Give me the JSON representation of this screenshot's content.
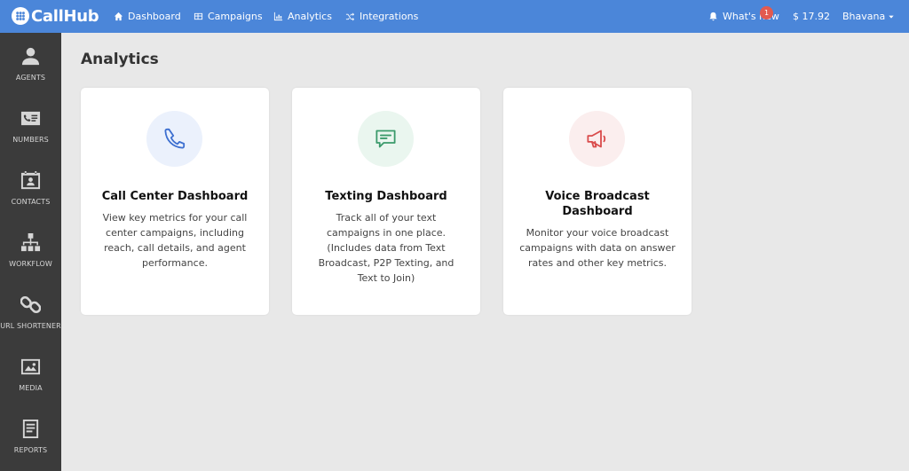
{
  "app": {
    "logo_text": "CallHub"
  },
  "topnav": {
    "items": [
      {
        "label": "Dashboard",
        "icon": "home-icon"
      },
      {
        "label": "Campaigns",
        "icon": "grid-icon"
      },
      {
        "label": "Analytics",
        "icon": "chart-icon"
      },
      {
        "label": "Integrations",
        "icon": "shuffle-icon"
      }
    ],
    "whats_new": {
      "label": "What's new",
      "badge": "1"
    },
    "balance": "$ 17.92",
    "user": "Bhavana"
  },
  "sidebar": {
    "items": [
      {
        "label": "AGENTS",
        "icon": "agent-icon"
      },
      {
        "label": "NUMBERS",
        "icon": "phone-card-icon"
      },
      {
        "label": "CONTACTS",
        "icon": "contact-card-icon"
      },
      {
        "label": "WORKFLOW",
        "icon": "sitemap-icon"
      },
      {
        "label": "URL SHORTENER",
        "icon": "link-icon"
      },
      {
        "label": "MEDIA",
        "icon": "image-icon"
      },
      {
        "label": "REPORTS",
        "icon": "document-icon"
      }
    ]
  },
  "main": {
    "title": "Analytics",
    "cards": [
      {
        "title": "Call Center Dashboard",
        "description": "View key metrics for your call center campaigns, including reach, call details, and agent performance.",
        "icon": "phone-icon",
        "accent": "#3d6fd0",
        "circle_bg": "#ebf1fc"
      },
      {
        "title": "Texting Dashboard",
        "description": "Track all of your text campaigns in one place. (Includes data from Text Broadcast, P2P Texting, and Text to Join)",
        "icon": "message-icon",
        "accent": "#3b9a6b",
        "circle_bg": "#eaf6ef"
      },
      {
        "title": "Voice Broadcast Dashboard",
        "description": "Monitor your voice broadcast campaigns with data on answer rates and other key metrics.",
        "icon": "megaphone-icon",
        "accent": "#d94b4b",
        "circle_bg": "#fbeeee"
      }
    ]
  },
  "colors": {
    "topbar": "#4b86d9",
    "sidebar": "#3b3b3b",
    "background": "#e8e8e8"
  }
}
